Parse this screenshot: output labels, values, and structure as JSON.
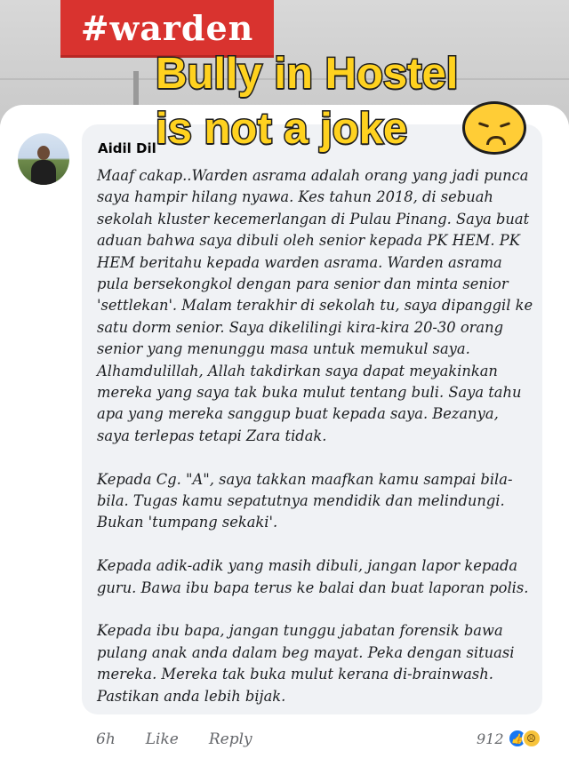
{
  "background_sign": {
    "text": "#warden"
  },
  "overlay": {
    "title_lines": [
      "Bully in Hostel",
      "is not a joke"
    ],
    "emoji": "sad-face-emoji",
    "color": "#ffd21f"
  },
  "comment": {
    "author": "Aidil Dil",
    "paragraphs": [
      "Maaf cakap..Warden asrama adalah orang yang jadi punca saya hampir hilang nyawa. Kes tahun 2018, di sebuah sekolah kluster kecemerlangan di Pulau Pinang. Saya buat aduan bahwa saya dibuli oleh senior kepada PK HEM. PK HEM beritahu kepada warden asrama. Warden asrama pula bersekongkol dengan para senior dan minta senior 'settlekan'. Malam terakhir di sekolah tu, saya dipanggil ke satu dorm senior. Saya dikelilingi kira-kira 20-30 orang senior yang menunggu masa untuk memukul saya. Alhamdulillah, Allah takdirkan saya dapat meyakinkan mereka yang saya tak buka mulut tentang buli. Saya tahu apa yang mereka sanggup buat kepada saya. Bezanya, saya terlepas tetapi Zara tidak.",
      "Kepada Cg. \"A\",  saya takkan maafkan kamu sampai bila-bila. Tugas kamu sepatutnya mendidik dan melindungi. Bukan 'tumpang sekaki'.",
      "Kepada adik-adik yang masih dibuli, jangan lapor kepada guru. Bawa ibu bapa terus ke balai dan buat laporan polis.",
      "Kepada ibu bapa, jangan tunggu jabatan forensik bawa pulang anak anda dalam beg mayat. Peka dengan situasi mereka. Mereka tak buka mulut kerana di-brainwash. Pastikan anda lebih bijak."
    ],
    "time": "6h",
    "like_label": "Like",
    "reply_label": "Reply",
    "reaction_count": "912",
    "reaction_icons": [
      "like-icon",
      "sad-icon"
    ],
    "accent": "#1877f2"
  }
}
